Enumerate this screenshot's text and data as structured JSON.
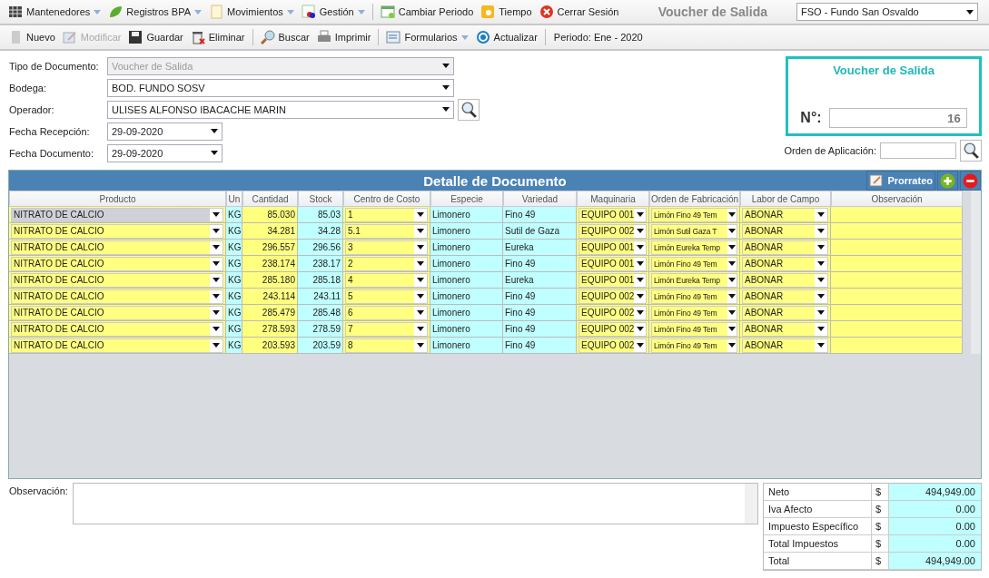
{
  "menu_bar": {
    "items": [
      {
        "label": "Mantenedores",
        "has_menu": true
      },
      {
        "label": "Registros BPA",
        "has_menu": true
      },
      {
        "label": "Movimientos",
        "has_menu": true
      },
      {
        "label": "Gestión",
        "has_menu": true
      },
      {
        "label": "Cambiar Periodo",
        "has_menu": false
      },
      {
        "label": "Tiempo",
        "has_menu": false
      },
      {
        "label": "Cerrar Sesión",
        "has_menu": false
      }
    ],
    "screen_title": "Voucher de Salida",
    "fund_select": {
      "value": "FSO - Fundo San Osvaldo"
    }
  },
  "toolbar": {
    "items": [
      {
        "label": "Nuevo",
        "disabled": false,
        "has_menu": false
      },
      {
        "label": "Modificar",
        "disabled": true,
        "has_menu": false
      },
      {
        "label": "Guardar",
        "disabled": false,
        "has_menu": false
      },
      {
        "label": "Eliminar",
        "disabled": false,
        "has_menu": false
      },
      {
        "label": "Buscar",
        "disabled": false,
        "has_menu": false
      },
      {
        "label": "Imprimir",
        "disabled": false,
        "has_menu": false
      },
      {
        "label": "Formularios",
        "disabled": false,
        "has_menu": true
      },
      {
        "label": "Actualizar",
        "disabled": false,
        "has_menu": false
      }
    ],
    "period": "Periodo: Ene - 2020"
  },
  "form": {
    "fields": [
      {
        "label": "Tipo de Documento:",
        "value": "Voucher de Salida",
        "kind": "select",
        "disabled": true,
        "has_search": false
      },
      {
        "label": "Bodega:",
        "value": "BOD. FUNDO SOSV",
        "kind": "select",
        "disabled": false,
        "has_search": false
      },
      {
        "label": "Operador:",
        "value": "ULISES ALFONSO IBACACHE MARIN",
        "kind": "select",
        "disabled": false,
        "has_search": true
      },
      {
        "label": "Fecha Recepción:",
        "value": "29-09-2020",
        "kind": "date",
        "disabled": false,
        "has_search": false
      },
      {
        "label": "Fecha Documento:",
        "value": "29-09-2020",
        "kind": "date",
        "disabled": false,
        "has_search": false
      }
    ]
  },
  "voucher_box": {
    "title": "Voucher de Salida",
    "number_label": "N°:",
    "number": "16"
  },
  "application_order": {
    "label": "Orden de Aplicación:"
  },
  "detail": {
    "title": "Detalle de Documento",
    "prorrateo_button": "Prorrateo",
    "columns": [
      "Producto",
      "Un",
      "Cantidad",
      "Stock",
      "Centro de Costo",
      "Especie",
      "Variedad",
      "Maquinaria",
      "Orden de Fabricación",
      "Labor de Campo",
      "Observación"
    ],
    "rows": [
      {
        "producto": "NITRATO DE CALCIO",
        "unidad": "KG",
        "cantidad": "85.030",
        "stock": "85.03",
        "centro_costo": "1",
        "especie": "Limonero",
        "variedad": "Fino 49",
        "maquinaria": "EQUIPO 001",
        "orden_fabricacion": "Limón Fino 49 Tem",
        "labor": "ABONAR",
        "selected": true
      },
      {
        "producto": "NITRATO DE CALCIO",
        "unidad": "KG",
        "cantidad": "34.281",
        "stock": "34.28",
        "centro_costo": "5.1",
        "especie": "Limonero",
        "variedad": "Sutil de Gaza",
        "maquinaria": "EQUIPO 002",
        "orden_fabricacion": "Limón Sutil Gaza T",
        "labor": "ABONAR",
        "selected": false
      },
      {
        "producto": "NITRATO DE CALCIO",
        "unidad": "KG",
        "cantidad": "296.557",
        "stock": "296.56",
        "centro_costo": "3",
        "especie": "Limonero",
        "variedad": "Eureka",
        "maquinaria": "EQUIPO 001",
        "orden_fabricacion": "Limón Eureka Temp",
        "labor": "ABONAR",
        "selected": false
      },
      {
        "producto": "NITRATO DE CALCIO",
        "unidad": "KG",
        "cantidad": "238.174",
        "stock": "238.17",
        "centro_costo": "2",
        "especie": "Limonero",
        "variedad": "Fino 49",
        "maquinaria": "EQUIPO 001",
        "orden_fabricacion": "Limón Fino 49 Tem",
        "labor": "ABONAR",
        "selected": false
      },
      {
        "producto": "NITRATO DE CALCIO",
        "unidad": "KG",
        "cantidad": "285.180",
        "stock": "285.18",
        "centro_costo": "4",
        "especie": "Limonero",
        "variedad": "Eureka",
        "maquinaria": "EQUIPO 001",
        "orden_fabricacion": "Limón Eureka Temp",
        "labor": "ABONAR",
        "selected": false
      },
      {
        "producto": "NITRATO DE CALCIO",
        "unidad": "KG",
        "cantidad": "243.114",
        "stock": "243.11",
        "centro_costo": "5",
        "especie": "Limonero",
        "variedad": "Fino 49",
        "maquinaria": "EQUIPO 002",
        "orden_fabricacion": "Limón Fino 49 Tem",
        "labor": "ABONAR",
        "selected": false
      },
      {
        "producto": "NITRATO DE CALCIO",
        "unidad": "KG",
        "cantidad": "285.479",
        "stock": "285.48",
        "centro_costo": "6",
        "especie": "Limonero",
        "variedad": "Fino 49",
        "maquinaria": "EQUIPO 002",
        "orden_fabricacion": "Limón Fino 49 Tem",
        "labor": "ABONAR",
        "selected": false
      },
      {
        "producto": "NITRATO DE CALCIO",
        "unidad": "KG",
        "cantidad": "278.593",
        "stock": "278.59",
        "centro_costo": "7",
        "especie": "Limonero",
        "variedad": "Fino 49",
        "maquinaria": "EQUIPO 002",
        "orden_fabricacion": "Limón Fino 49 Tem",
        "labor": "ABONAR",
        "selected": false
      },
      {
        "producto": "NITRATO DE CALCIO",
        "unidad": "KG",
        "cantidad": "203.593",
        "stock": "203.59",
        "centro_costo": "8",
        "especie": "Limonero",
        "variedad": "Fino 49",
        "maquinaria": "EQUIPO 002",
        "orden_fabricacion": "Limón Fino 49 Tem",
        "labor": "ABONAR",
        "selected": false
      }
    ]
  },
  "observation": {
    "label": "Observación:"
  },
  "totals": [
    {
      "label": "Neto",
      "currency": "$",
      "value": "494,949.00"
    },
    {
      "label": "Iva Afecto",
      "currency": "$",
      "value": "0.00"
    },
    {
      "label": "Impuesto Específico",
      "currency": "$",
      "value": "0.00"
    },
    {
      "label": "Total Impuestos",
      "currency": "$",
      "value": "0.00"
    },
    {
      "label": "Total",
      "currency": "$",
      "value": "494,949.00"
    }
  ]
}
